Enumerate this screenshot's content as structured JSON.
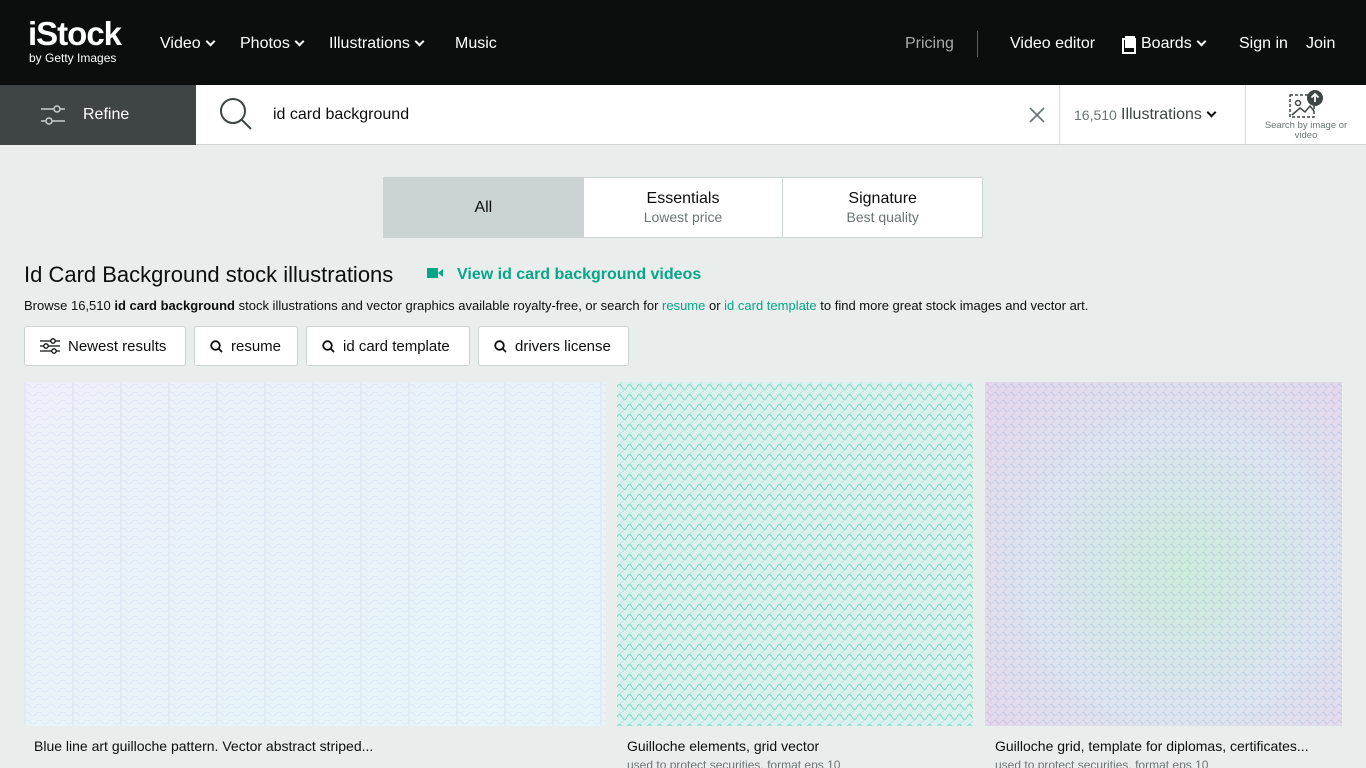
{
  "nav": {
    "brand": "iStock",
    "brand_sub": "by Getty Images",
    "items": [
      {
        "label": "Video"
      },
      {
        "label": "Photos"
      },
      {
        "label": "Illustrations"
      },
      {
        "label": "Music"
      }
    ],
    "pricing": "Pricing",
    "video_editor": "Video editor",
    "boards": "Boards",
    "sign_in": "Sign in",
    "join": "Join"
  },
  "search": {
    "refine": "Refine",
    "query": "id card background",
    "count": "16,510",
    "asset_type": "Illustrations",
    "search_by_image": "Search by image or video"
  },
  "tabs": [
    {
      "title": "All",
      "subtitle": ""
    },
    {
      "title": "Essentials",
      "subtitle": "Lowest price"
    },
    {
      "title": "Signature",
      "subtitle": "Best quality"
    }
  ],
  "heading": {
    "title": "Id Card Background stock illustrations",
    "video_link": "View id card background videos"
  },
  "browse": {
    "prefix": "Browse 16,510 ",
    "term": "id card background",
    "middle": " stock illustrations and vector graphics available royalty-free, or search for ",
    "link1": "resume",
    "or": " or ",
    "link2": "id card template",
    "suffix": " to find more great stock images and vector art."
  },
  "chips": [
    {
      "label": "Newest results",
      "icon": "filter-icon"
    },
    {
      "label": "resume",
      "icon": "search-icon"
    },
    {
      "label": "id card template",
      "icon": "search-icon"
    },
    {
      "label": "drivers license",
      "icon": "search-icon"
    }
  ],
  "results": [
    {
      "caption": "Blue line art guilloche pattern. Vector abstract striped...",
      "sub": ""
    },
    {
      "caption": "Guilloche elements, grid vector",
      "sub": "used to protect securities, format eps 10"
    },
    {
      "caption": "Guilloche grid, template for diplomas, certificates...",
      "sub": "used to protect securities, format eps 10"
    }
  ],
  "colors": {
    "accent": "#08a586",
    "nav_bg": "#0c0d0d",
    "refine_bg": "#3f4444",
    "page_bg": "#e9eeed"
  }
}
